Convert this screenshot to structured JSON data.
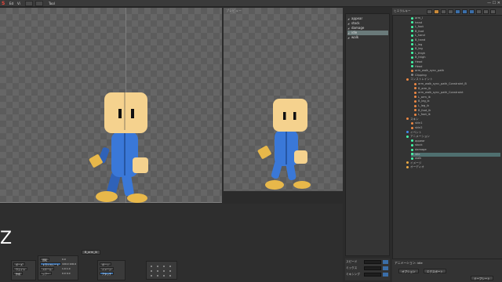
{
  "titlebar": {
    "menus": [
      "Ed",
      "Vi",
      "Tool"
    ]
  },
  "viewport_left": {
    "label": ""
  },
  "viewport_right": {
    "label": "プレビュー"
  },
  "anim_list": {
    "items": [
      "appear",
      "stock",
      "damage",
      "idle",
      "walk"
    ],
    "selected_index": 3
  },
  "hierarchy": {
    "title": "ヒエラルキー",
    "rows": [
      {
        "text": "arm_l",
        "indent": 24,
        "color": "#4fa"
      },
      {
        "text": "head",
        "indent": 24,
        "color": "#4fa"
      },
      {
        "text": "L_foot",
        "indent": 24,
        "color": "#4fa"
      },
      {
        "text": "B_foot",
        "indent": 24,
        "color": "#4fa"
      },
      {
        "text": "L_hand",
        "indent": 24,
        "color": "#4fa"
      },
      {
        "text": "B_hand",
        "indent": 24,
        "color": "#4fa"
      },
      {
        "text": "L_leg",
        "indent": 24,
        "color": "#4fa"
      },
      {
        "text": "B_leg",
        "indent": 24,
        "color": "#4fa"
      },
      {
        "text": "L_thigh",
        "indent": 24,
        "color": "#4fa"
      },
      {
        "text": "B_thigh",
        "indent": 24,
        "color": "#4fa"
      },
      {
        "text": "Head",
        "indent": 24,
        "color": "#4fa"
      },
      {
        "text": "Head",
        "indent": 24,
        "color": "#4fa"
      },
      {
        "text": "arm_walk_sync_path",
        "indent": 24,
        "color": "#e84"
      },
      {
        "text": "Clipping",
        "indent": 24,
        "color": "#888"
      },
      {
        "text": "コンストレイント",
        "indent": 18,
        "color": "#e84"
      },
      {
        "text": "arm_walk_sync_path_Constraint_B",
        "indent": 28,
        "color": "#e84"
      },
      {
        "text": "B_arm_ik",
        "indent": 28,
        "color": "#e84"
      },
      {
        "text": "arm_walk_sync_path_Constraint",
        "indent": 28,
        "color": "#e84"
      },
      {
        "text": "L_arm_ik",
        "indent": 28,
        "color": "#e84"
      },
      {
        "text": "B_leg_ik",
        "indent": 28,
        "color": "#e84"
      },
      {
        "text": "L_leg_ik",
        "indent": 28,
        "color": "#e84"
      },
      {
        "text": "B_foot_ik",
        "indent": 28,
        "color": "#e84"
      },
      {
        "text": "L_foot_ik",
        "indent": 28,
        "color": "#e84"
      },
      {
        "text": "スキン",
        "indent": 18,
        "color": "#e84"
      },
      {
        "text": "skin1",
        "indent": 24,
        "color": "#e84"
      },
      {
        "text": "skin2",
        "indent": 24,
        "color": "#e84"
      },
      {
        "text": "イベント",
        "indent": 18,
        "color": "#48e"
      },
      {
        "text": "アニメーション",
        "indent": 18,
        "color": "#4fa"
      },
      {
        "text": "appear",
        "indent": 24,
        "color": "#4fa"
      },
      {
        "text": "stock",
        "indent": 24,
        "color": "#4fa"
      },
      {
        "text": "damage",
        "indent": 24,
        "color": "#4fa"
      },
      {
        "text": "idle",
        "indent": 24,
        "color": "#4fa"
      },
      {
        "text": "walk",
        "indent": 24,
        "color": "#4fa"
      },
      {
        "text": "イメージ",
        "indent": 18,
        "color": "#ea4"
      },
      {
        "text": "オーディオ",
        "indent": 18,
        "color": "#ea4"
      }
    ],
    "selected_index": 31
  },
  "bottom": {
    "bone_tag": "B_arm_ik",
    "z_key": "Z",
    "props": [
      {
        "label": "回転",
        "value": "0.0"
      },
      {
        "label": "トランスレート",
        "value": "100.0   100.0"
      },
      {
        "label": "スケール",
        "value": "1.0    1.0"
      },
      {
        "label": "シアー",
        "value": "0.0    0.0"
      }
    ],
    "side_buttons": [
      "ポーズ",
      "ウェイト",
      "作成"
    ],
    "right_buttons": [
      "ボーン",
      "イメージ",
      "アタッチ"
    ]
  },
  "opacity": {
    "rows": [
      "スピード",
      "ミックス",
      "ミキシング"
    ]
  },
  "anim_footer": {
    "label": "アニメーション: idle",
    "buttons": [
      "オプション",
      "エクスポート",
      "ドープシート"
    ]
  },
  "colors": {
    "accent": "#3b6ea8",
    "skin": "#f5d28e",
    "suit": "#3a78d8",
    "shoe": "#e8b84a"
  }
}
